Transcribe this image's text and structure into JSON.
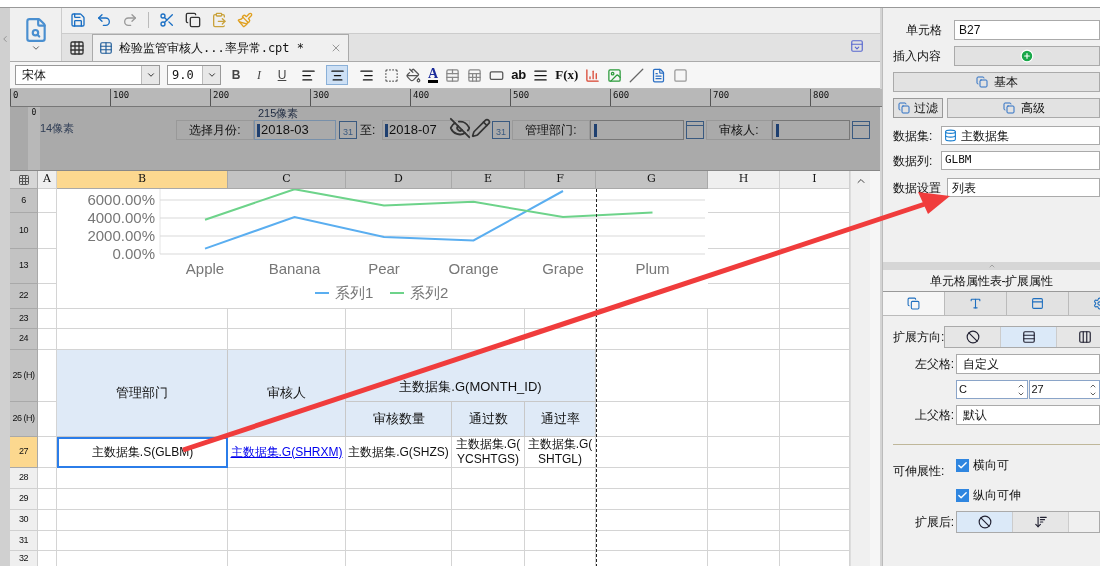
{
  "toolbar": {
    "tab": {
      "title": "检验监管审核人...率异常.cpt *",
      "selected": true
    }
  },
  "format_bar": {
    "font": "宋体",
    "size": "9.0",
    "bold": "B",
    "italic": "I",
    "underline": "U",
    "align": [
      {
        "kind": "left",
        "selected": false
      },
      {
        "kind": "center",
        "selected": true
      },
      {
        "kind": "right",
        "selected": false
      }
    ],
    "font_color": "A",
    "text_tool": "ab",
    "formula": "F(x)"
  },
  "ruler": {
    "ticks": [
      "0",
      "100",
      "200",
      "300",
      "400",
      "500",
      "600",
      "700",
      "800"
    ],
    "side": "0"
  },
  "parameters": {
    "left_hint": "14像素",
    "width_hint": "215像素",
    "month_label": "选择月份:",
    "from": "2018-03",
    "from_day": "31",
    "to_label": "至:",
    "to": "2018-07",
    "to_day": "31",
    "dept_label": "管理部门:",
    "reviewer_label": "审核人:"
  },
  "sheet": {
    "columns": [
      {
        "label": "A",
        "selected": false,
        "shaded": false
      },
      {
        "label": "B",
        "selected": true,
        "shaded": true
      },
      {
        "label": "C",
        "selected": false,
        "shaded": true
      },
      {
        "label": "D",
        "selected": false,
        "shaded": true
      },
      {
        "label": "E",
        "selected": false,
        "shaded": true
      },
      {
        "label": "F",
        "selected": false,
        "shaded": true
      },
      {
        "label": "G",
        "selected": false,
        "shaded": true
      },
      {
        "label": "H",
        "selected": false,
        "shaded": false
      },
      {
        "label": "I",
        "selected": false,
        "shaded": false
      }
    ],
    "rows": [
      {
        "label": "6",
        "selected": false,
        "shaded": true
      },
      {
        "label": "10",
        "selected": false,
        "shaded": true
      },
      {
        "label": "13",
        "selected": false,
        "shaded": true
      },
      {
        "label": "22",
        "selected": false,
        "shaded": true
      },
      {
        "label": "23",
        "selected": false,
        "shaded": true
      },
      {
        "label": "24",
        "selected": false,
        "shaded": true
      },
      {
        "label": "25 (H)",
        "selected": false,
        "shaded": true
      },
      {
        "label": "26 (H)",
        "selected": false,
        "shaded": true
      },
      {
        "label": "27",
        "selected": true,
        "shaded": true
      },
      {
        "label": "28",
        "selected": false,
        "shaded": false
      },
      {
        "label": "29",
        "selected": false,
        "shaded": false
      },
      {
        "label": "30",
        "selected": false,
        "shaded": false
      },
      {
        "label": "31",
        "selected": false,
        "shaded": false
      },
      {
        "label": "32",
        "selected": false,
        "shaded": false
      }
    ],
    "chart_data": {
      "type": "line",
      "categories": [
        "Apple",
        "Banana",
        "Pear",
        "Orange",
        "Grape",
        "Plum"
      ],
      "series": [
        {
          "name": "系列1",
          "color": "#5aaef0",
          "values": [
            600,
            4100,
            1900,
            1500,
            7000,
            null
          ]
        },
        {
          "name": "系列2",
          "color": "#6dd38a",
          "values": [
            3800,
            7200,
            5400,
            5800,
            4100,
            4600
          ]
        }
      ],
      "grid": true,
      "legend": "bottom",
      "ylim": [
        0,
        7200
      ],
      "yticks": [
        {
          "value": 0,
          "label": "0.00%"
        },
        {
          "value": 2000,
          "label": "2000.00%"
        },
        {
          "value": 4000,
          "label": "4000.00%"
        },
        {
          "value": 6000,
          "label": "6000.00%"
        }
      ]
    },
    "header": [
      {
        "text": "管理部门"
      },
      {
        "text": "审核人"
      },
      {
        "text": "主数据集.G(MONTH_ID)"
      },
      {
        "text": "审核数量"
      },
      {
        "text": "通过数"
      },
      {
        "text": "通过率"
      }
    ],
    "data_row": [
      {
        "kind": "text",
        "lines": [
          "主数据集.S(GLBM)"
        ],
        "selected": true
      },
      {
        "kind": "link",
        "lines": [
          "主数据集.G(SHRXM)"
        ],
        "selected": false
      },
      {
        "kind": "text",
        "lines": [
          "主数据集.G(SHZS)"
        ],
        "selected": false
      },
      {
        "kind": "text",
        "lines": [
          "主数据集.G(",
          "YCSHTGS)"
        ],
        "selected": false
      },
      {
        "kind": "text",
        "lines": [
          "主数据集.G(",
          "SHTGL)"
        ],
        "selected": false
      }
    ]
  },
  "cell_panel": {
    "cell_label": "单元格",
    "cell": "B27",
    "insert_label": "插入内容",
    "basic": "基本",
    "filter": "过滤",
    "advanced": "高级",
    "dataset_label": "数据集:",
    "dataset": "主数据集",
    "column_label": "数据列:",
    "column": "GLBM",
    "setting_label": "数据设置",
    "setting": "列表"
  },
  "props": {
    "title": "单元格属性表-扩展属性",
    "tabs": [
      {
        "kind": "cell",
        "selected": true
      },
      {
        "kind": "font",
        "selected": false
      },
      {
        "kind": "widget",
        "selected": false
      },
      {
        "kind": "settings",
        "selected": false
      }
    ],
    "direction_label": "扩展方向:",
    "direction": [
      {
        "kind": "none",
        "selected": false
      },
      {
        "kind": "vertical",
        "selected": true
      },
      {
        "kind": "horizontal",
        "selected": false
      }
    ],
    "left_parent_label": "左父格:",
    "left_parent": "自定义",
    "left_col": "C",
    "left_row": "27",
    "top_parent_label": "上父格:",
    "top_parent": "默认",
    "stretch_label": "可伸展性:",
    "stretch": [
      {
        "label": "横向可",
        "checked": true
      },
      {
        "label": "纵向可伸",
        "checked": true
      }
    ],
    "after_label": "扩展后:",
    "after": [
      {
        "kind": "none",
        "selected": true
      },
      {
        "kind": "sort",
        "selected": false
      }
    ]
  }
}
